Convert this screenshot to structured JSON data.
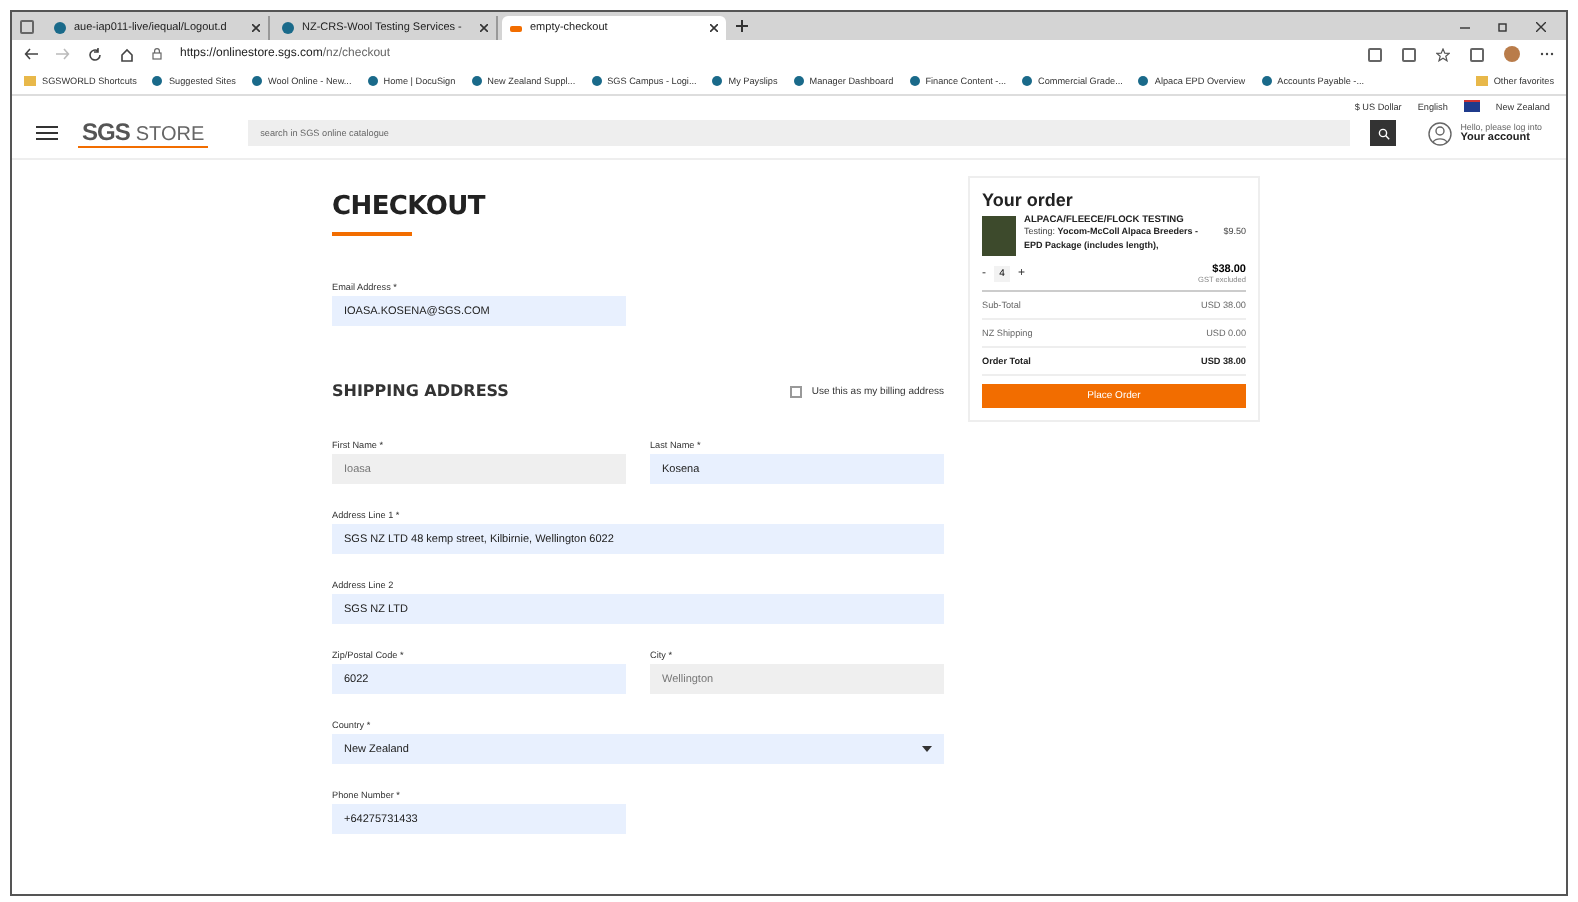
{
  "browser": {
    "tabs": [
      {
        "title": "aue-iap011-live/iequal/Logout.d",
        "selected": false
      },
      {
        "title": "NZ-CRS-Wool Testing Services -",
        "selected": false
      },
      {
        "title": "empty-checkout",
        "selected": true
      }
    ],
    "address": {
      "host": "https://onlinestore.sgs.com",
      "path": "/nz/checkout"
    },
    "bookmarks": [
      "SGSWORLD Shortcuts",
      "Suggested Sites",
      "Wool Online - New...",
      "Home | DocuSign",
      "New Zealand Suppl...",
      "SGS Campus - Logi...",
      "My Payslips",
      "Manager Dashboard",
      "Finance Content -...",
      "Commercial Grade...",
      "Alpaca EPD Overview",
      "Accounts Payable -..."
    ],
    "other_favorites": "Other favorites"
  },
  "store": {
    "topbar": {
      "currency": "$ US Dollar",
      "language": "English",
      "country": "New Zealand"
    },
    "logo": {
      "brand": "SGS",
      "store": "STORE"
    },
    "search": {
      "placeholder": "search in SGS online catalogue"
    },
    "account": {
      "greeting": "Hello, please log into",
      "title": "Your account"
    }
  },
  "checkout": {
    "title": "CHECKOUT",
    "email": {
      "label": "Email Address *",
      "value": "IOASA.KOSENA@SGS.COM",
      "disabled": false
    },
    "shipping_title": "SHIPPING ADDRESS",
    "billing_checkbox": {
      "label": "Use this as my billing address",
      "checked": false
    },
    "rows": [
      {
        "fields": [
          {
            "kind": "text",
            "label": "First Name *",
            "value": "Ioasa",
            "disabled": true
          },
          {
            "kind": "text",
            "label": "Last Name *",
            "value": "Kosena",
            "disabled": false
          }
        ]
      },
      {
        "fields": [
          {
            "kind": "wide_text",
            "label": "Address Line 1 *",
            "value": "SGS NZ LTD 48 kemp street, Kilbirnie, Wellington 6022",
            "disabled": false
          }
        ]
      },
      {
        "fields": [
          {
            "kind": "wide_text",
            "label": "Address Line 2",
            "value": "SGS NZ LTD",
            "disabled": false
          }
        ]
      },
      {
        "fields": [
          {
            "kind": "text",
            "label": "Zip/Postal Code *",
            "value": "6022",
            "disabled": false
          },
          {
            "kind": "text",
            "label": "City *",
            "value": "Wellington",
            "disabled": true
          }
        ]
      },
      {
        "fields": [
          {
            "kind": "select",
            "label": "Country *",
            "value": "New Zealand",
            "disabled": false
          }
        ]
      },
      {
        "fields": [
          {
            "kind": "text",
            "label": "Phone Number *",
            "value": "+64275731433",
            "disabled": false
          }
        ]
      }
    ]
  },
  "order": {
    "title": "Your order",
    "item": {
      "name": "ALPACA/FLEECE/FLOCK TESTING",
      "prefix": "Testing:",
      "detail": "Yocom-McColl Alpaca Breeders - EPD Package (includes length),",
      "unit_price": "$9.50",
      "decrease": "-",
      "quantity": "4",
      "increase": "+",
      "price": "$38.00",
      "tax_note": "GST excluded"
    },
    "totals": [
      {
        "label": "Sub-Total",
        "value": "USD 38.00",
        "bold": false
      },
      {
        "label": "NZ Shipping",
        "value": "USD 0.00",
        "bold": false
      },
      {
        "label": "Order Total",
        "value": "USD 38.00",
        "bold": true
      }
    ],
    "button": "Place Order"
  }
}
